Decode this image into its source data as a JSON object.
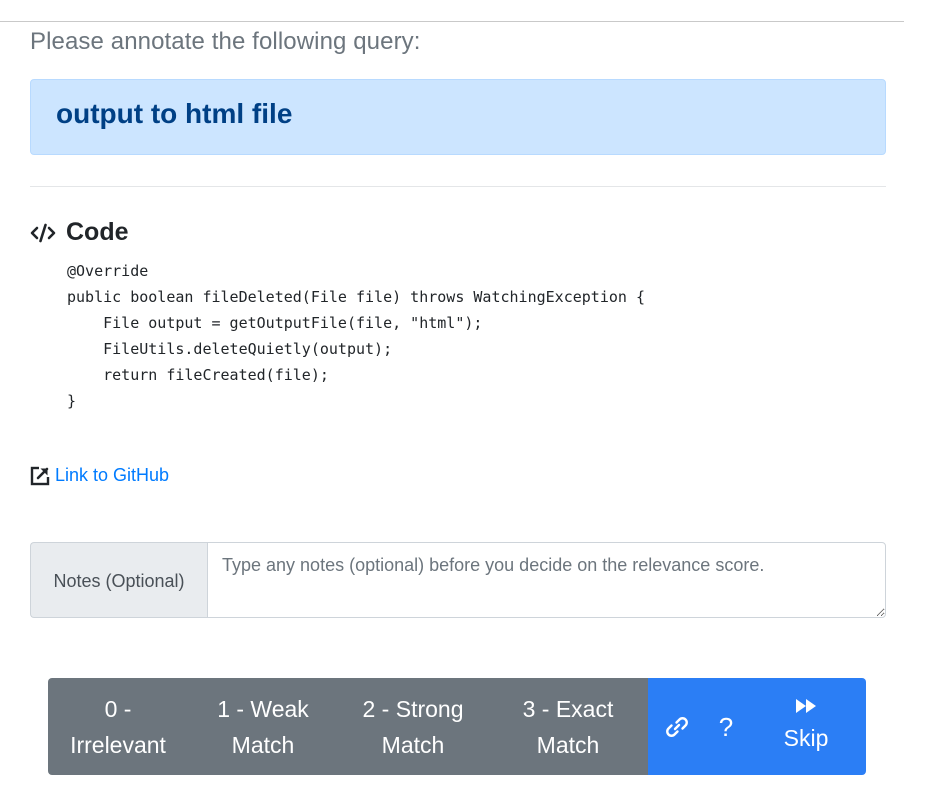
{
  "prompt": "Please annotate the following query:",
  "query": "output to html file",
  "code_section": {
    "title": "Code",
    "icon": "code-icon",
    "lines": [
      "@Override",
      "public boolean fileDeleted(File file) throws WatchingException {",
      "    File output = getOutputFile(file, \"html\");",
      "    FileUtils.deleteQuietly(output);",
      "    return fileCreated(file);",
      "}"
    ]
  },
  "github_link": {
    "label": "Link to GitHub",
    "icon": "external-link-icon"
  },
  "notes": {
    "label": "Notes (Optional)",
    "placeholder": "Type any notes (optional) before you decide on the relevance score.",
    "value": ""
  },
  "buttons": {
    "score_0": [
      "0 -",
      "Irrelevant"
    ],
    "score_1": [
      "1 - Weak",
      "Match"
    ],
    "score_2": [
      "2 - Strong",
      "Match"
    ],
    "score_3": [
      "3 - Exact",
      "Match"
    ],
    "help_label": "?",
    "skip_label": "Skip",
    "link_icon": "link-icon",
    "skip_icon": "fast-forward-icon"
  },
  "colors": {
    "query_bg": "#cce5ff",
    "query_text": "#004085",
    "score_button_bg": "#6c757d",
    "action_button_bg": "#2b7ef5",
    "link": "#007bff"
  }
}
